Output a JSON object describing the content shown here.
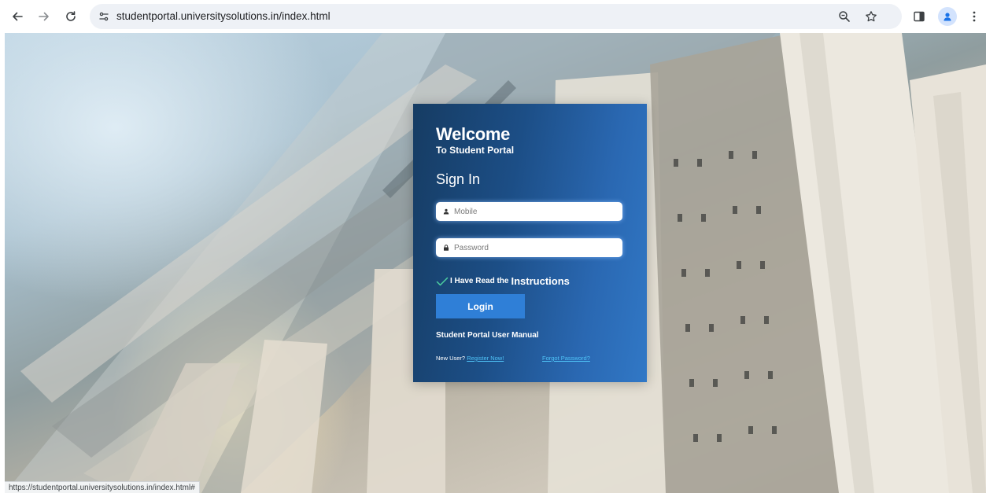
{
  "browser": {
    "url": "studentportal.universitysolutions.in/index.html",
    "status_url": "https://studentportal.universitysolutions.in/index.html#",
    "icons": [
      "back-icon",
      "forward-icon",
      "reload-icon",
      "site-info-icon",
      "zoom-icon",
      "bookmark-star-icon",
      "side-panel-icon",
      "profile-avatar-icon",
      "menu-kebab-icon"
    ]
  },
  "login": {
    "welcome": "Welcome",
    "subtitle": "To Student Portal",
    "heading": "Sign In",
    "mobile_placeholder": "Mobile",
    "password_placeholder": "Password",
    "checkbox_text": "I Have Read the",
    "instructions_link": "Instructions",
    "login_button": "Login",
    "manual_link": "Student Portal User Manual",
    "new_user_text": "New User?",
    "register_link": "Register Now!",
    "forgot_link": "Forgot Password?"
  },
  "colors": {
    "card_dark": "#163c63",
    "card_light": "#3178c6",
    "button": "#2f7fd7",
    "link": "#4fc3f7",
    "check": "#4dd0a0"
  }
}
